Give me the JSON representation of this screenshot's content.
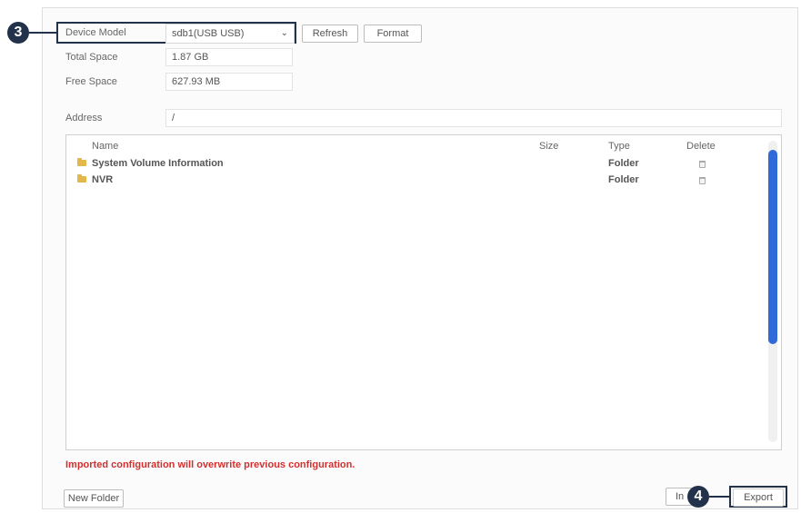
{
  "callouts": {
    "step_3": "3",
    "step_4": "4"
  },
  "device": {
    "model_label": "Device Model",
    "model_value": "sdb1(USB USB)",
    "total_space_label": "Total Space",
    "total_space_value": "1.87 GB",
    "free_space_label": "Free Space",
    "free_space_value": "627.93 MB"
  },
  "buttons": {
    "refresh": "Refresh",
    "format": "Format",
    "new_folder": "New Folder",
    "import_partial": "In",
    "export": "Export"
  },
  "address": {
    "label": "Address",
    "value": "/"
  },
  "table": {
    "headers": {
      "name": "Name",
      "size": "Size",
      "type": "Type",
      "delete": "Delete"
    },
    "rows": [
      {
        "name": "System Volume Information",
        "size": "",
        "type": "Folder"
      },
      {
        "name": "NVR",
        "size": "",
        "type": "Folder"
      }
    ]
  },
  "warning": "Imported configuration will overwrite previous configuration.",
  "colors": {
    "callout": "#22324a",
    "warning": "#d32f2f",
    "scroll_thumb": "#2f6ad8",
    "folder": "#e2b84b"
  },
  "icons": {
    "folder": "folder-icon",
    "trash": "trash-icon",
    "chevron": "chevron-down-icon"
  }
}
